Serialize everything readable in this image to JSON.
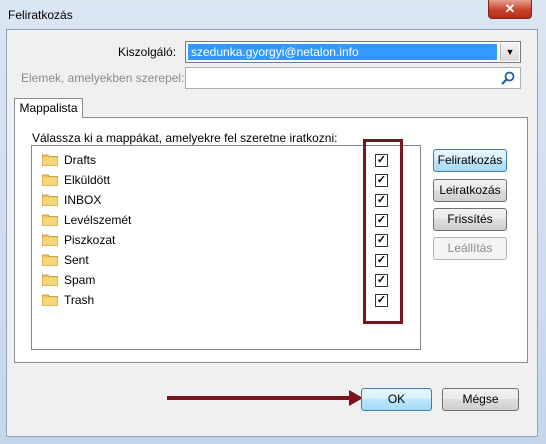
{
  "window": {
    "title": "Feliratkozás",
    "close_label": "✕"
  },
  "server": {
    "label": "Kiszolgáló:",
    "selected": "szedunka.gyorgyi@netalon.info"
  },
  "filter": {
    "label": "Elemek, amelyekben szerepel:",
    "value": ""
  },
  "tab": {
    "label": "Mappalista"
  },
  "instruction": "Válassza ki a mappákat, amelyekre fel szeretne iratkozni:",
  "folders": [
    {
      "name": "Drafts",
      "checked": true
    },
    {
      "name": "Elküldött",
      "checked": true
    },
    {
      "name": "INBOX",
      "checked": true
    },
    {
      "name": "Levélszemét",
      "checked": true
    },
    {
      "name": "Piszkozat",
      "checked": true
    },
    {
      "name": "Sent",
      "checked": true
    },
    {
      "name": "Spam",
      "checked": true
    },
    {
      "name": "Trash",
      "checked": true
    }
  ],
  "side_buttons": {
    "subscribe": "Feliratkozás",
    "unsubscribe": "Leiratkozás",
    "refresh": "Frissítés",
    "stop": "Leállítás"
  },
  "footer": {
    "ok": "OK",
    "cancel": "Mégse"
  },
  "colors": {
    "annotation": "#7a1520",
    "selection": "#3399ff"
  }
}
